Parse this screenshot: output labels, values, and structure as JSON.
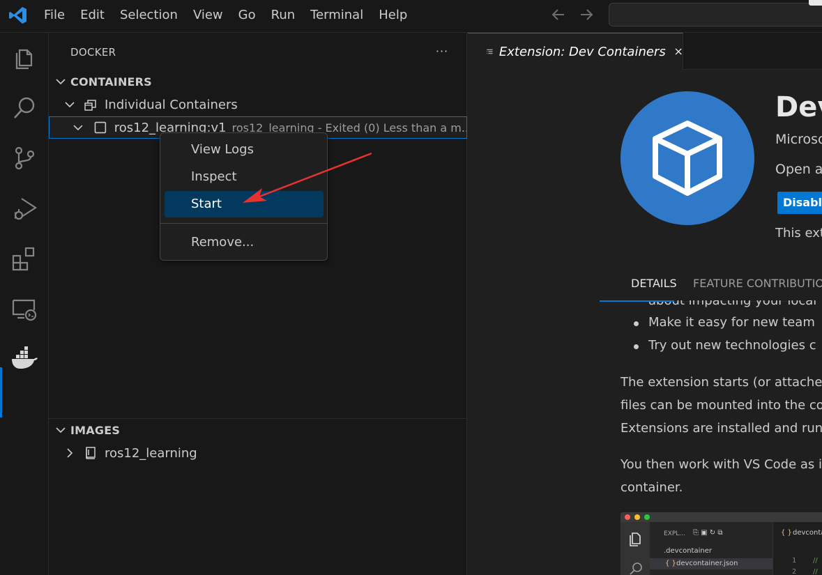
{
  "menu": [
    "File",
    "Edit",
    "Selection",
    "View",
    "Go",
    "Run",
    "Terminal",
    "Help"
  ],
  "sidebar": {
    "title": "DOCKER",
    "more": "···",
    "containers_header": "CONTAINERS",
    "group_label": "Individual Containers",
    "container": {
      "label": "ros12_learning:v1",
      "description": "ros12_learning - Exited (0) Less than a m..."
    },
    "images_header": "IMAGES",
    "image": {
      "label": "ros12_learning"
    }
  },
  "context_menu": {
    "items": [
      "View Logs",
      "Inspect",
      "Start",
      "Remove..."
    ],
    "active_index": 2
  },
  "editor": {
    "tab_label": "Extension: Dev Containers",
    "ext_name": "Dev",
    "ext_publisher": "Microso",
    "ext_desc": "Open a",
    "button": "Disable",
    "note": "This exte",
    "detail_tabs": [
      "DETAILS",
      "FEATURE CONTRIBUTIONS"
    ],
    "readme": {
      "partial_top": "about impacting your local",
      "bullets": [
        "Make it easy for new team",
        "Try out new technologies c"
      ],
      "para1": [
        "The extension starts (or attaches t",
        "files can be mounted into the con",
        "Extensions are installed and run in"
      ],
      "para2": [
        "You then work with VS Code as if",
        "container."
      ]
    },
    "screenshot": {
      "explorer": "EXPL...",
      "folder": ".devcontainer",
      "file": "devcontainer.json",
      "tab": "devconta",
      "line1": "1",
      "line2": "2",
      "comment": "//"
    }
  },
  "colors": {
    "accent": "#0078d4",
    "menu_active": "#04395e",
    "logo_blue": "#3079c9",
    "arrow": "#e8322f"
  }
}
